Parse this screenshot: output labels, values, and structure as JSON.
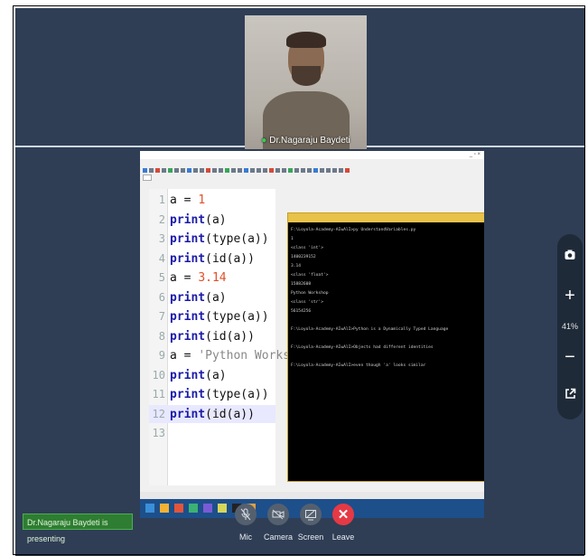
{
  "meeting": {
    "participant_name": "Dr.Nagaraju Baydeti",
    "presenting_label": "Dr.Nagaraju Baydeti is presenting",
    "zoom_level": "41%"
  },
  "controls": {
    "mic": "Mic",
    "camera": "Camera",
    "screen": "Screen",
    "leave": "Leave"
  },
  "icons": {
    "snapshot": "camera-snapshot-icon",
    "zoom_in": "plus-icon",
    "zoom_out": "minus-icon",
    "popout": "external-link-icon",
    "mic": "mic-off-icon",
    "camera": "camera-off-icon",
    "screen": "screen-share-off-icon",
    "leave": "close-icon"
  },
  "code_lines": [
    {
      "n": "1",
      "tokens": [
        {
          "t": "a = ",
          "c": "plain"
        },
        {
          "t": "1",
          "c": "num"
        }
      ]
    },
    {
      "n": "2",
      "tokens": [
        {
          "t": "print",
          "c": "kw"
        },
        {
          "t": "(a)",
          "c": "plain"
        }
      ]
    },
    {
      "n": "3",
      "tokens": [
        {
          "t": "print",
          "c": "kw"
        },
        {
          "t": "(type(a))",
          "c": "plain"
        }
      ]
    },
    {
      "n": "4",
      "tokens": [
        {
          "t": "print",
          "c": "kw"
        },
        {
          "t": "(id(a))",
          "c": "plain"
        }
      ]
    },
    {
      "n": "5",
      "tokens": [
        {
          "t": "a = ",
          "c": "plain"
        },
        {
          "t": "3.14",
          "c": "num"
        }
      ]
    },
    {
      "n": "6",
      "tokens": [
        {
          "t": "print",
          "c": "kw"
        },
        {
          "t": "(a)",
          "c": "plain"
        }
      ]
    },
    {
      "n": "7",
      "tokens": [
        {
          "t": "print",
          "c": "kw"
        },
        {
          "t": "(type(a))",
          "c": "plain"
        }
      ]
    },
    {
      "n": "8",
      "tokens": [
        {
          "t": "print",
          "c": "kw"
        },
        {
          "t": "(id(a))",
          "c": "plain"
        }
      ]
    },
    {
      "n": "9",
      "tokens": [
        {
          "t": "a = ",
          "c": "plain"
        },
        {
          "t": "'Python Workshop'",
          "c": "str"
        }
      ]
    },
    {
      "n": "10",
      "tokens": [
        {
          "t": "print",
          "c": "kw"
        },
        {
          "t": "(a)",
          "c": "plain"
        }
      ]
    },
    {
      "n": "11",
      "tokens": [
        {
          "t": "print",
          "c": "kw"
        },
        {
          "t": "(type(a))",
          "c": "plain"
        }
      ]
    },
    {
      "n": "12",
      "tokens": [
        {
          "t": "print",
          "c": "kw"
        },
        {
          "t": "(id(a))",
          "c": "plain"
        }
      ],
      "highlight": true
    },
    {
      "n": "13",
      "tokens": []
    }
  ],
  "console_lines": [
    "F:\\Loyola-Academy-AIwAlI>py UnderstandVariables.py",
    "1",
    "<class 'int'>",
    "1400239152",
    "3.14",
    "<class 'float'>",
    "15882608",
    "Python Workshop",
    "<class 'str'>",
    "56154256",
    "",
    "F:\\Loyola-Academy-AIwAlI>Python is a Dynamically Typed Language",
    "",
    "F:\\Loyola-Academy-AIwAlI>Objects had different identities",
    "",
    "F:\\Loyola-Academy-AIwAlI>even though 'a' looks similar"
  ]
}
